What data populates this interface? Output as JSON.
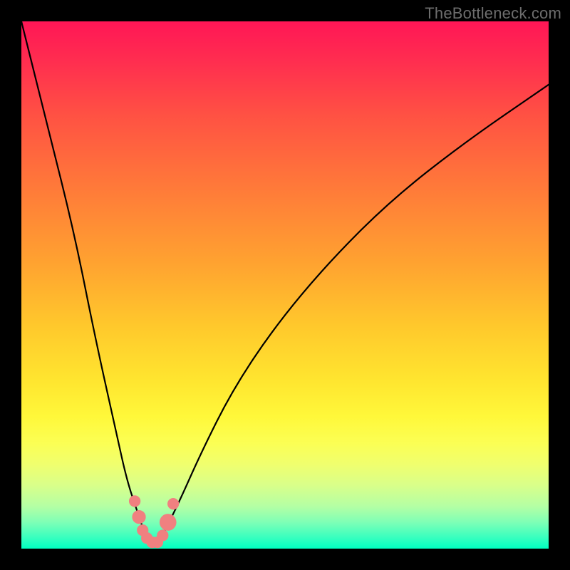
{
  "watermark": "TheBottleneck.com",
  "colors": {
    "frame": "#000000",
    "gradient_top": "#ff1656",
    "gradient_mid": "#ffe52f",
    "gradient_bottom": "#00ffc0",
    "curve": "#000000",
    "marker": "#f08080"
  },
  "chart_data": {
    "type": "line",
    "title": "",
    "xlabel": "",
    "ylabel": "",
    "xlim": [
      0,
      100
    ],
    "ylim": [
      0,
      100
    ],
    "series": [
      {
        "name": "bottleneck-curve",
        "x": [
          0,
          5,
          10,
          14,
          18,
          20,
          22,
          23,
          24,
          25,
          26,
          27,
          30,
          34,
          40,
          48,
          58,
          70,
          84,
          100
        ],
        "values": [
          100,
          80,
          60,
          40,
          22,
          13,
          7,
          4,
          2,
          1,
          1,
          3,
          9,
          18,
          30,
          42,
          54,
          66,
          77,
          88
        ]
      }
    ],
    "markers": {
      "name": "highlighted-points",
      "x": [
        21.5,
        22.3,
        23.0,
        23.8,
        24.8,
        25.8,
        26.8,
        27.8,
        28.8
      ],
      "values": [
        9.0,
        6.0,
        3.5,
        2.0,
        1.2,
        1.2,
        2.5,
        5.0,
        8.5
      ],
      "radius": [
        1.1,
        1.3,
        1.1,
        1.1,
        1.1,
        1.1,
        1.1,
        1.6,
        1.1
      ]
    }
  }
}
